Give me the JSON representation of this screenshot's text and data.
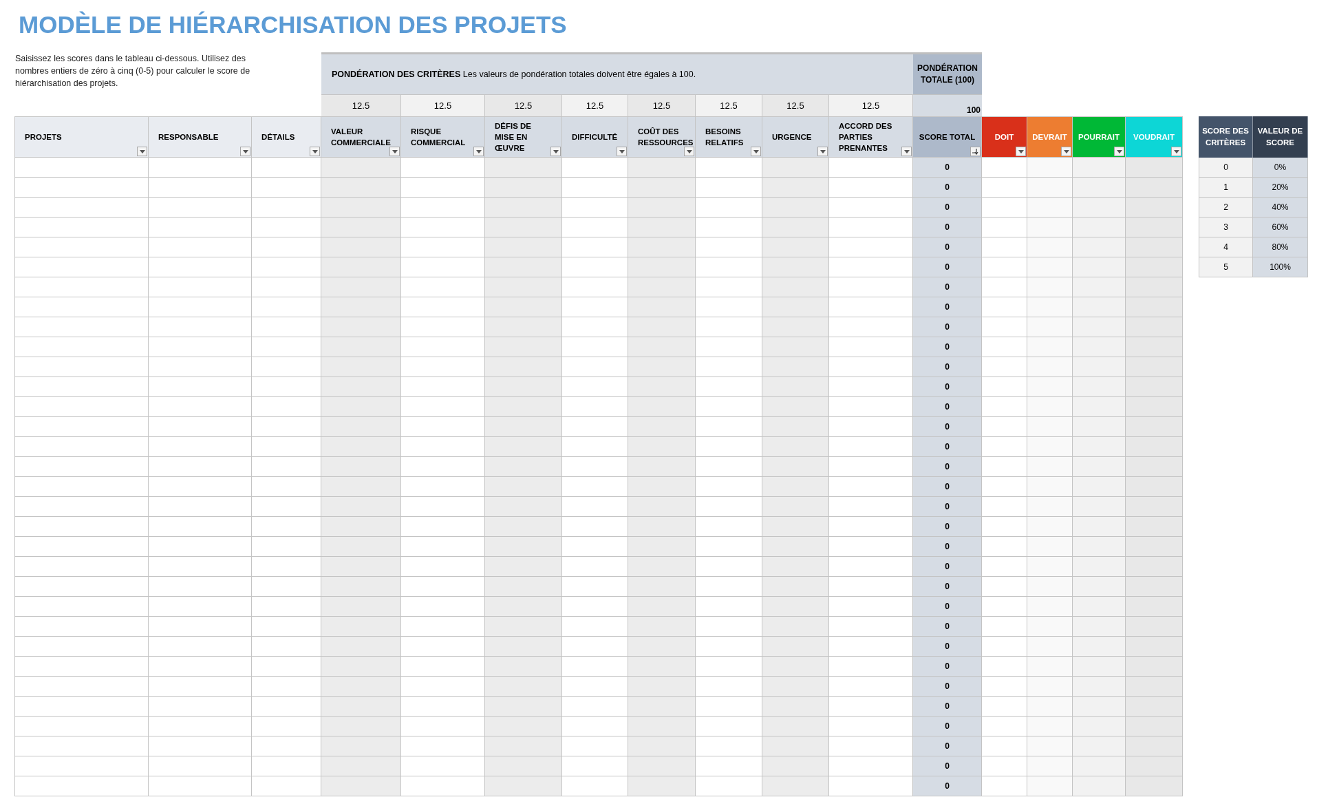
{
  "title": "MODÈLE DE HIÉRARCHISATION DES PROJETS",
  "instructions": "Saisissez les scores dans le tableau ci-dessous. Utilisez des nombres entiers de zéro à cinq (0-5) pour calculer le score de hiérarchisation des projets.",
  "weighting": {
    "label": "**PONDÉRATION DES CRITÈRES** Les valeurs de pondération totales doivent être égales à 100.",
    "values": [
      "12.5",
      "12.5",
      "12.5",
      "12.5",
      "12.5",
      "12.5",
      "12.5",
      "12.5"
    ],
    "total_header": "PONDÉRATION TOTALE (100)",
    "total_value": "100"
  },
  "columns": [
    {
      "label": "PROJETS",
      "kind": "text"
    },
    {
      "label": "RESPONSABLE",
      "kind": "text"
    },
    {
      "label": "DÉTAILS",
      "kind": "text"
    },
    {
      "label": "VALEUR COMMERCIALE",
      "kind": "criterion"
    },
    {
      "label": "RISQUE COMMERCIAL",
      "kind": "criterion"
    },
    {
      "label": "DÉFIS DE MISE EN ŒUVRE",
      "kind": "criterion"
    },
    {
      "label": "DIFFICULTÉ",
      "kind": "criterion"
    },
    {
      "label": "COÛT DES RESSOURCES",
      "kind": "criterion"
    },
    {
      "label": "BESOINS RELATIFS",
      "kind": "criterion"
    },
    {
      "label": "URGENCE",
      "kind": "criterion"
    },
    {
      "label": "ACCORD DES PARTIES PRENANTES",
      "kind": "criterion"
    },
    {
      "label": "SCORE TOTAL",
      "kind": "total"
    },
    {
      "label": "DOIT",
      "kind": "priority",
      "color": "#d9301a"
    },
    {
      "label": "DEVRAIT",
      "kind": "priority",
      "color": "#ed7d31"
    },
    {
      "label": "POURRAIT",
      "kind": "priority",
      "color": "#00b836"
    },
    {
      "label": "VOUDRAIT",
      "kind": "priority",
      "color": "#0dd6d6"
    }
  ],
  "score_totals": [
    "0",
    "0",
    "0",
    "0",
    "0",
    "0",
    "0",
    "0",
    "0",
    "0",
    "0",
    "0",
    "0",
    "0",
    "0",
    "0",
    "0",
    "0",
    "0",
    "0",
    "0",
    "0",
    "0",
    "0",
    "0",
    "0",
    "0",
    "0",
    "0",
    "0",
    "0",
    "0"
  ],
  "score_table": {
    "headers": [
      "SCORE DES CRITÈRES",
      "VALEUR DE SCORE"
    ],
    "rows": [
      {
        "score": "0",
        "value": "0%"
      },
      {
        "score": "1",
        "value": "20%"
      },
      {
        "score": "2",
        "value": "40%"
      },
      {
        "score": "3",
        "value": "60%"
      },
      {
        "score": "4",
        "value": "80%"
      },
      {
        "score": "5",
        "value": "100%"
      }
    ]
  }
}
